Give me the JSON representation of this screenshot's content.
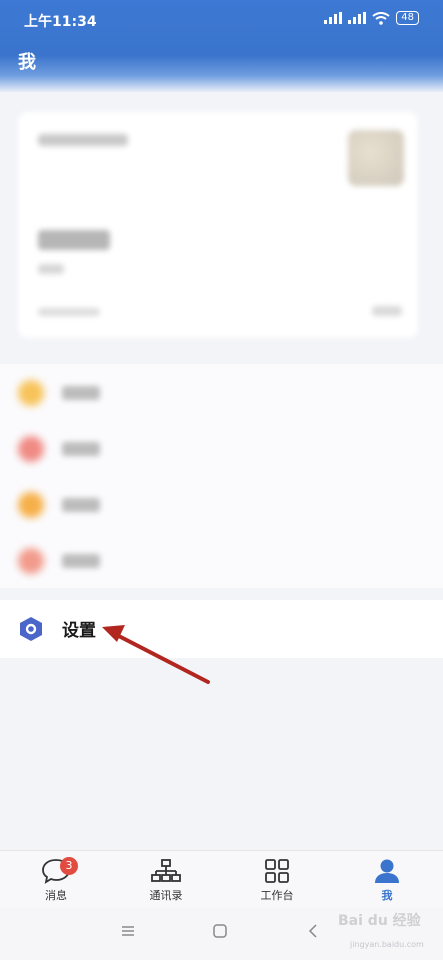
{
  "status_bar": {
    "time": "上午11:34",
    "battery": "48"
  },
  "header": {
    "title": "我"
  },
  "settings": {
    "label": "设置"
  },
  "tabs": [
    {
      "label": "消息",
      "badge": "3",
      "icon": "message-icon"
    },
    {
      "label": "通讯录",
      "icon": "org-chart-icon"
    },
    {
      "label": "工作台",
      "icon": "grid-icon"
    },
    {
      "label": "我",
      "icon": "person-icon",
      "active": true
    }
  ],
  "watermark": {
    "text": "Bai du 经验",
    "sub": "jingyan.baidu.com"
  },
  "colors": {
    "accent": "#3a74cc",
    "badge": "#e24b3f",
    "arrow": "#b1261f"
  }
}
